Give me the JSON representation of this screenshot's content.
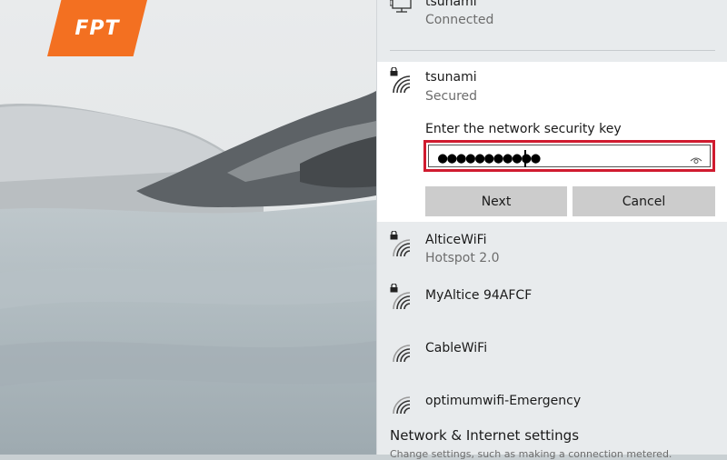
{
  "logo": {
    "text": "FPT",
    "color": "#f37021"
  },
  "connected_network": {
    "name": "tsunami",
    "status": "Connected",
    "icon": "ethernet-pc-icon"
  },
  "selected_network": {
    "name": "tsunami",
    "status": "Secured",
    "icon": "wifi-secured-icon",
    "prompt": "Enter the network security key",
    "key_value": "●●●●●●●●●●●",
    "reveal_icon": "eye-icon",
    "next_label": "Next",
    "cancel_label": "Cancel",
    "highlight_color": "#d01b2f"
  },
  "networks": [
    {
      "name": "AlticeWiFi",
      "status": "Hotspot 2.0",
      "secured": true
    },
    {
      "name": "MyAltice 94AFCF",
      "status": "",
      "secured": true
    },
    {
      "name": "CableWiFi",
      "status": "",
      "secured": false
    },
    {
      "name": "optimumwifi-Emergency",
      "status": "",
      "secured": false
    }
  ],
  "footer": {
    "settings_link": "Network & Internet settings",
    "settings_sub": "Change settings, such as making a connection metered."
  }
}
